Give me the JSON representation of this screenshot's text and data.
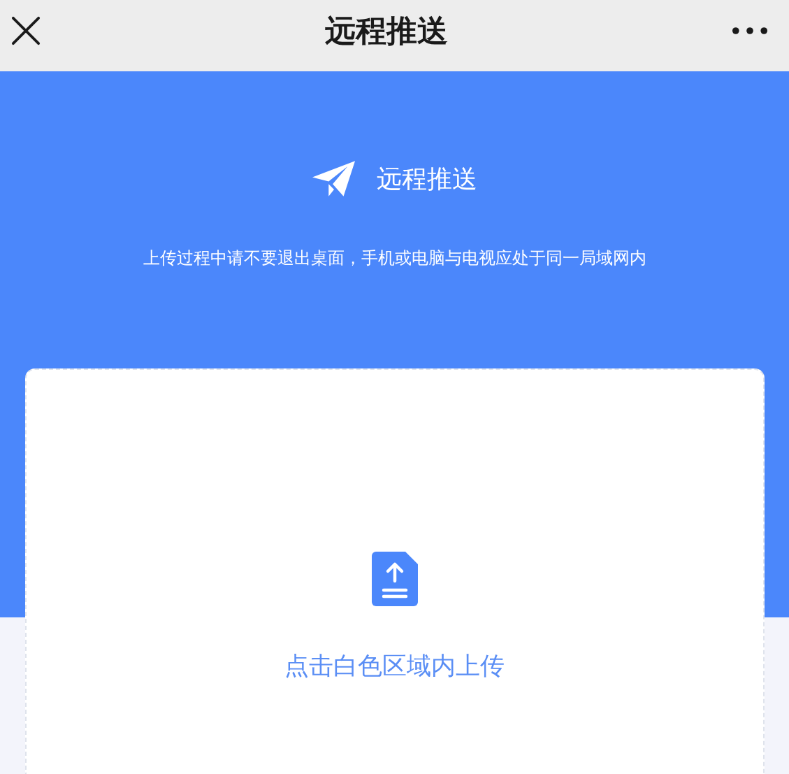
{
  "nav_bar": {
    "title": "远程推送"
  },
  "header": {
    "title": "远程推送",
    "notice": "上传过程中请不要退出桌面，手机或电脑与电视应处于同一局域网内"
  },
  "upload_area": {
    "prompt": "点击白色区域内上传"
  }
}
